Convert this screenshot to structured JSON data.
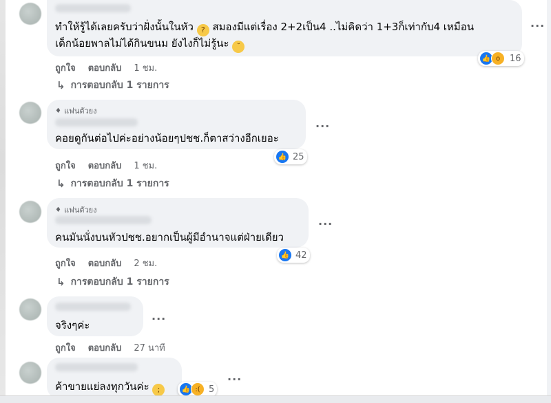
{
  "comments": [
    {
      "text_lines": [
        "ทำให้รู้ได้เลยครับว่าฝั่งนั้นในหัว",
        "สมองมีแต่เรื่อง 2+2เป็น4 ..ไม่คิดว่า 1+3ก็เท่ากับ4 เหมือน",
        "เด็กน้อยพาลไม่ได้กินขนม ยังไงก็ไม่รู้นะ"
      ],
      "actions": {
        "like": "ถูกใจ",
        "reply": "ตอบกลับ",
        "time": "1 ชม."
      },
      "reaction_count": "16",
      "replies_label": "การตอบกลับ 1 รายการ"
    },
    {
      "badge": "แฟนตัวยง",
      "text": "คอยดูกันต่อไปค่ะอย่างน้อยๆปชช.ก็ตาสว่างอีกเยอะ",
      "actions": {
        "like": "ถูกใจ",
        "reply": "ตอบกลับ",
        "time": "1 ชม."
      },
      "reaction_count": "25",
      "replies_label": "การตอบกลับ 1 รายการ"
    },
    {
      "badge": "แฟนตัวยง",
      "text": "คนมันนั่งบนหัวปชช.อยากเป็นผู้มีอำนาจแต่ฝ่ายเดียว",
      "actions": {
        "like": "ถูกใจ",
        "reply": "ตอบกลับ",
        "time": "2 ชม."
      },
      "reaction_count": "42",
      "replies_label": "การตอบกลับ 1 รายการ"
    },
    {
      "text": "จริงๆค่ะ",
      "actions": {
        "like": "ถูกใจ",
        "reply": "ตอบกลับ",
        "time": "27 นาที"
      }
    },
    {
      "text": "ค้าขายแย่ลงทุกวันค่ะ",
      "reaction_count": "5"
    }
  ],
  "more_icon": "···",
  "reply_arrow": "↳",
  "icons": {
    "like": "like-reaction-icon",
    "wow": "wow-reaction-icon",
    "badge": "diamond-badge-icon"
  },
  "colors": {
    "bubble": "#f0f2f5",
    "like_blue": "#1877f2",
    "muted_text": "#65676b"
  }
}
